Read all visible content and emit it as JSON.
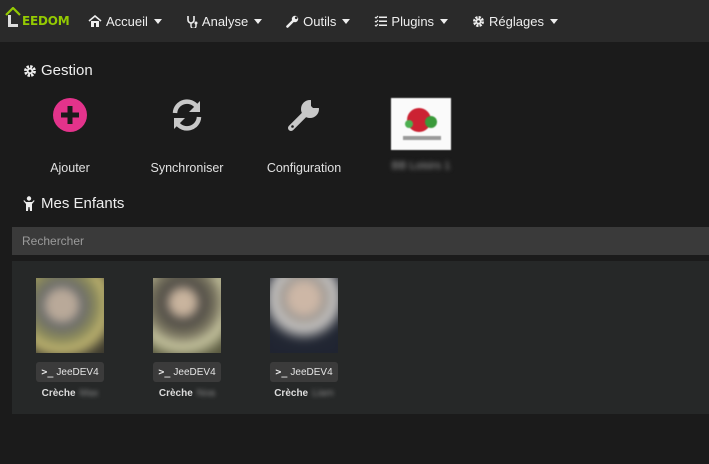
{
  "brand": {
    "name": "EEDOM",
    "color": "#94ca02"
  },
  "nav": {
    "items": [
      {
        "label": "Accueil",
        "icon": "home-icon"
      },
      {
        "label": "Analyse",
        "icon": "stethoscope-icon"
      },
      {
        "label": "Outils",
        "icon": "wrench-icon"
      },
      {
        "label": "Plugins",
        "icon": "tasks-icon"
      },
      {
        "label": "Réglages",
        "icon": "gear-icon"
      }
    ]
  },
  "gestion": {
    "title": "Gestion",
    "tiles": [
      {
        "label": "Ajouter",
        "icon": "plus-circle-icon",
        "color": "#e3338b"
      },
      {
        "label": "Synchroniser",
        "icon": "sync-icon"
      },
      {
        "label": "Configuration",
        "icon": "wrench-icon"
      },
      {
        "label": "BB Loisirs 1",
        "icon": "plugin-logo"
      }
    ]
  },
  "enfants": {
    "title": "Mes Enfants",
    "search_placeholder": "Rechercher",
    "children": [
      {
        "tag": "JeeDEV4",
        "name": "Crèche",
        "name_suffix": "Max"
      },
      {
        "tag": "JeeDEV4",
        "name": "Crèche",
        "name_suffix": "Noa"
      },
      {
        "tag": "JeeDEV4",
        "name": "Crèche",
        "name_suffix": "Liam"
      }
    ]
  }
}
